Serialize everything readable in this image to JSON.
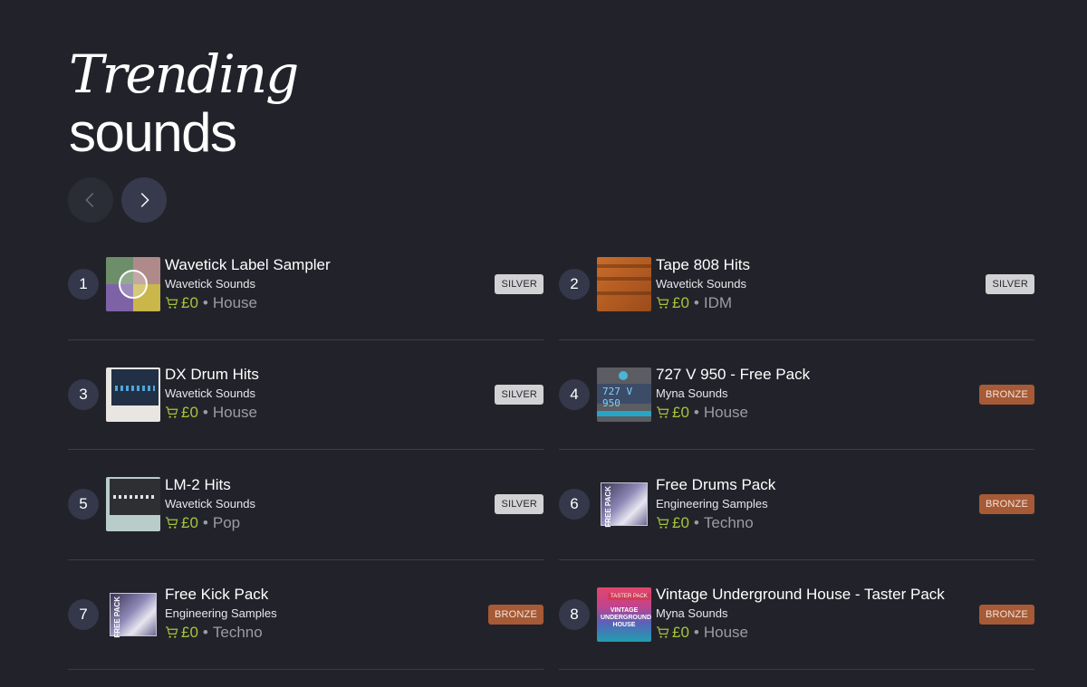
{
  "heading": {
    "line1": "Trending",
    "line2": "sounds"
  },
  "nav": {
    "prev_icon": "chevron-left-icon",
    "next_icon": "chevron-right-icon"
  },
  "colors": {
    "price": "#a7c43a",
    "silver_badge": "#d2d2d4",
    "bronze_badge": "#a65a36",
    "background": "#22232a"
  },
  "items": [
    {
      "rank": "1",
      "title": "Wavetick Label Sampler",
      "artist": "Wavetick Sounds",
      "price": "£0",
      "genre": "House",
      "badge": "SILVER"
    },
    {
      "rank": "2",
      "title": "Tape 808 Hits",
      "artist": "Wavetick Sounds",
      "price": "£0",
      "genre": "IDM",
      "badge": "SILVER"
    },
    {
      "rank": "3",
      "title": "DX Drum Hits",
      "artist": "Wavetick Sounds",
      "price": "£0",
      "genre": "House",
      "badge": "SILVER"
    },
    {
      "rank": "4",
      "title": "727 V 950 - Free Pack",
      "artist": "Myna Sounds",
      "price": "£0",
      "genre": "House",
      "badge": "BRONZE",
      "cover_text": "727 V 950"
    },
    {
      "rank": "5",
      "title": "LM-2 Hits",
      "artist": "Wavetick Sounds",
      "price": "£0",
      "genre": "Pop",
      "badge": "SILVER"
    },
    {
      "rank": "6",
      "title": "Free Drums Pack",
      "artist": "Engineering Samples",
      "price": "£0",
      "genre": "Techno",
      "badge": "BRONZE",
      "cover_text": "FREE PACK"
    },
    {
      "rank": "7",
      "title": "Free Kick Pack",
      "artist": "Engineering Samples",
      "price": "£0",
      "genre": "Techno",
      "badge": "BRONZE",
      "cover_text": "FREE PACK"
    },
    {
      "rank": "8",
      "title": "Vintage Underground House - Taster Pack",
      "artist": "Myna Sounds",
      "price": "£0",
      "genre": "House",
      "badge": "BRONZE",
      "cover_text": "VINTAGE UNDERGROUND HOUSE",
      "cover_tag": "TASTER PACK"
    }
  ]
}
